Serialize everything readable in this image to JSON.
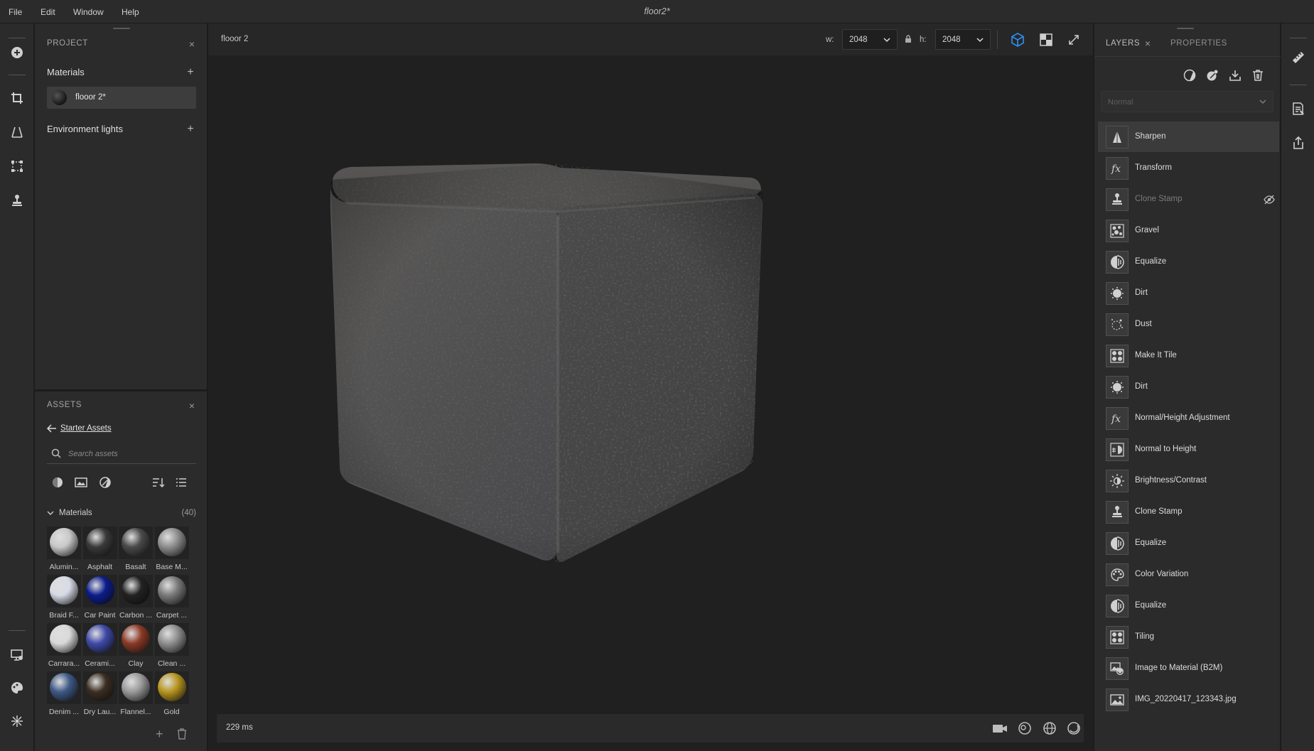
{
  "menubar": {
    "items": [
      "File",
      "Edit",
      "Window",
      "Help"
    ],
    "document_title": "floor2*"
  },
  "project": {
    "title": "PROJECT",
    "materials_label": "Materials",
    "material_item": "flooor 2*",
    "env_lights_label": "Environment lights"
  },
  "assets": {
    "title": "ASSETS",
    "back_label": "Starter Assets",
    "search_placeholder": "Search assets",
    "section_label": "Materials",
    "section_count": "(40)",
    "materials": [
      {
        "name": "Alumin...",
        "color": "#c8c8c8"
      },
      {
        "name": "Asphalt",
        "color": "#3a3a3a"
      },
      {
        "name": "Basalt",
        "color": "#4a4a4a"
      },
      {
        "name": "Base M...",
        "color": "#8e8e8e"
      },
      {
        "name": "Braid F...",
        "color": "#d7dbe6"
      },
      {
        "name": "Car Paint",
        "color": "#0b1d8c"
      },
      {
        "name": "Carbon ...",
        "color": "#222222"
      },
      {
        "name": "Carpet ...",
        "color": "#7a7a7a"
      },
      {
        "name": "Carrara...",
        "color": "#d9d9d9"
      },
      {
        "name": "Cerami...",
        "color": "#3f4aa8"
      },
      {
        "name": "Clay",
        "color": "#8a3a26"
      },
      {
        "name": "Clean ...",
        "color": "#8f8f8f"
      },
      {
        "name": "Denim ...",
        "color": "#3e5a86"
      },
      {
        "name": "Dry Lau...",
        "color": "#3b2e22"
      },
      {
        "name": "Flannel...",
        "color": "#9a9a9a"
      },
      {
        "name": "Gold",
        "color": "#b8961f"
      }
    ]
  },
  "viewport": {
    "doc_name": "flooor 2",
    "w_label": "w:",
    "w_value": "2048",
    "h_label": "h:",
    "h_value": "2048",
    "render_time": "229 ms",
    "accent": "#2d8ceb"
  },
  "layers_panel": {
    "tab_layers": "LAYERS",
    "tab_properties": "PROPERTIES",
    "blend_mode": "Normal",
    "layers": [
      {
        "name": "Sharpen",
        "icon": "sharpen-icon",
        "selected": true,
        "hidden": false
      },
      {
        "name": "Transform",
        "icon": "fx-icon",
        "selected": false,
        "hidden": false
      },
      {
        "name": "Clone Stamp",
        "icon": "stamp-icon",
        "selected": false,
        "hidden": true
      },
      {
        "name": "Gravel",
        "icon": "gravel-icon",
        "selected": false,
        "hidden": false
      },
      {
        "name": "Equalize",
        "icon": "equalize-icon",
        "selected": false,
        "hidden": false
      },
      {
        "name": "Dirt",
        "icon": "dirt-icon",
        "selected": false,
        "hidden": false
      },
      {
        "name": "Dust",
        "icon": "dust-icon",
        "selected": false,
        "hidden": false
      },
      {
        "name": "Make It Tile",
        "icon": "tile-icon",
        "selected": false,
        "hidden": false
      },
      {
        "name": "Dirt",
        "icon": "dirt-icon",
        "selected": false,
        "hidden": false
      },
      {
        "name": "Normal/Height Adjustment",
        "icon": "fx-icon",
        "selected": false,
        "hidden": false
      },
      {
        "name": "Normal to Height",
        "icon": "normal-height-icon",
        "selected": false,
        "hidden": false
      },
      {
        "name": "Brightness/Contrast",
        "icon": "brightness-icon",
        "selected": false,
        "hidden": false
      },
      {
        "name": "Clone Stamp",
        "icon": "stamp-icon",
        "selected": false,
        "hidden": false
      },
      {
        "name": "Equalize",
        "icon": "equalize-icon",
        "selected": false,
        "hidden": false
      },
      {
        "name": "Color Variation",
        "icon": "palette-icon",
        "selected": false,
        "hidden": false
      },
      {
        "name": "Equalize",
        "icon": "equalize-icon",
        "selected": false,
        "hidden": false
      },
      {
        "name": "Tiling",
        "icon": "tile-icon",
        "selected": false,
        "hidden": false
      },
      {
        "name": "Image to Material (B2M)",
        "icon": "b2m-icon",
        "selected": false,
        "hidden": false
      },
      {
        "name": "IMG_20220417_123343.jpg",
        "icon": "image-icon",
        "selected": false,
        "hidden": false
      }
    ]
  }
}
